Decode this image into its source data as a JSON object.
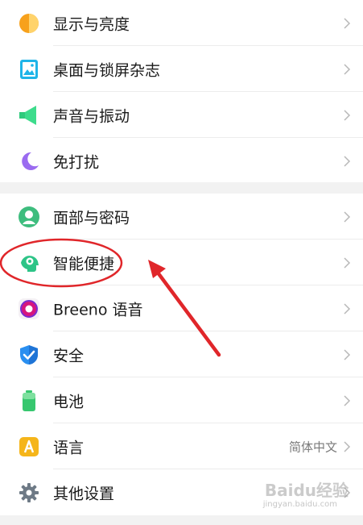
{
  "group1": [
    {
      "label": "显示与亮度",
      "icon": "display-brightness-icon"
    },
    {
      "label": "桌面与锁屏杂志",
      "icon": "wallpaper-icon"
    },
    {
      "label": "声音与振动",
      "icon": "sound-icon"
    },
    {
      "label": "免打扰",
      "icon": "moon-icon"
    }
  ],
  "group2": [
    {
      "label": "面部与密码",
      "icon": "face-password-icon"
    },
    {
      "label": "智能便捷",
      "icon": "smart-head-icon"
    },
    {
      "label": "Breeno 语音",
      "icon": "breeno-icon"
    },
    {
      "label": "安全",
      "icon": "shield-icon"
    },
    {
      "label": "电池",
      "icon": "battery-icon"
    },
    {
      "label": "语言",
      "icon": "language-icon",
      "value": "简体中文"
    },
    {
      "label": "其他设置",
      "icon": "gear-icon"
    }
  ],
  "watermark": {
    "text": "Baidu经验",
    "sub": "jingyan.baidu.com"
  },
  "colors": {
    "annotation": "#e0262a",
    "divider": "#ececec",
    "gap": "#f2f2f2"
  }
}
